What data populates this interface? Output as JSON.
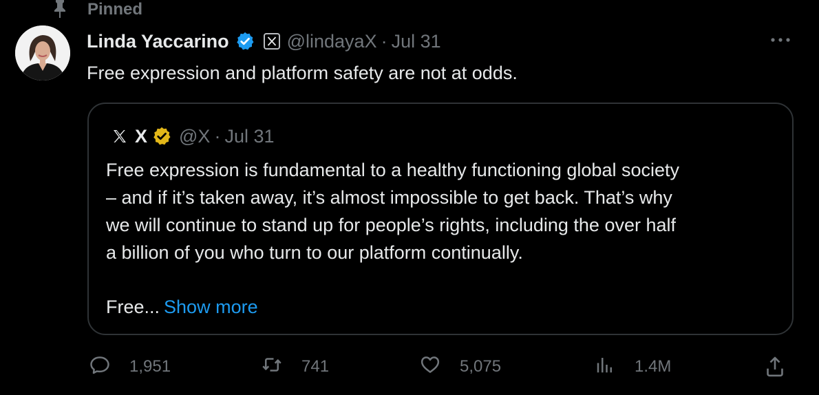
{
  "pinned": {
    "label": "Pinned",
    "icon": "pin-icon"
  },
  "tweet": {
    "author": {
      "name": "Linda Yaccarino",
      "handle": "@lindayaX",
      "date": "Jul 31",
      "separator": "·",
      "badges": [
        "verified-icon",
        "affiliate-x-badge"
      ]
    },
    "text": "Free expression and platform safety are not at odds.",
    "more_icon": "more-icon"
  },
  "quote": {
    "logo_icon": "x-logo-icon",
    "name": "X",
    "handle": "@X",
    "separator": "·",
    "date": "Jul 31",
    "badge": "gold-verified-icon",
    "lines": [
      "Free expression is fundamental to a healthy functioning global society",
      "– and if it’s taken away, it’s almost impossible to get back. That’s why",
      "we will continue to stand up for people’s rights, including the over half",
      "a billion of you who turn to our platform continually."
    ],
    "truncated_text": "Free...",
    "show_more": "Show more"
  },
  "actions": {
    "replies": "1,951",
    "reposts": "741",
    "likes": "5,075",
    "views": "1.4M"
  },
  "colors": {
    "background": "#000000",
    "text": "#e7e9ea",
    "secondary": "#71767b",
    "link": "#1d9bf0",
    "verified_blue": "#1d9bf0",
    "verified_gold": "#e2b719",
    "border": "#2f3336"
  }
}
